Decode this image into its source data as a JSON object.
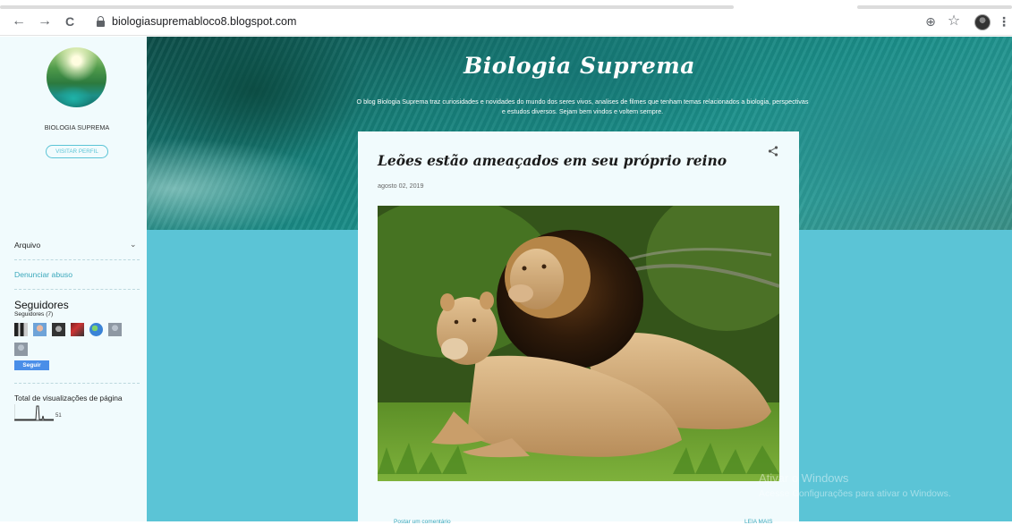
{
  "browser": {
    "url": "biologiasupremabloco8.blogspot.com",
    "back_icon": "←",
    "forward_icon": "→",
    "reload_icon": "C",
    "zoom_icon": "⊕",
    "star_icon": "☆",
    "menu_icon": "⋮"
  },
  "blog": {
    "title": "Biologia Suprema",
    "description": "O blog Biologia Suprema traz curiosidades e novidades do mundo dos seres vivos, analises de filmes que tenham temas relacionados a biologia, perspectivas e estudos diversos. Sejam bem vindos e voltem sempre."
  },
  "sidebar": {
    "profile_name": "BIOLOGIA SUPREMA",
    "visit_profile_label": "VISITAR PERFIL",
    "archive_label": "Arquivo",
    "archive_chevron": "⌄",
    "report_abuse_label": "Denunciar abuso",
    "followers_title": "Seguidores",
    "followers_count": "Seguidores (7)",
    "follow_button": "Seguir",
    "pageviews_title": "Total de visualizações de página",
    "pageviews_value": "51"
  },
  "post": {
    "title": "Leões estão ameaçados em seu próprio reino",
    "date": "agosto 02, 2019",
    "comment_link": "Postar um comentário",
    "read_more": "LEIA MAIS"
  },
  "watermark": {
    "line1": "Ativar o Windows",
    "line2": "Acesse Configurações para ativar o Windows."
  },
  "colors": {
    "accent": "#5bc4d6",
    "sidebar_bg": "#f1fbfd",
    "follow_button": "#4a8ee8"
  }
}
